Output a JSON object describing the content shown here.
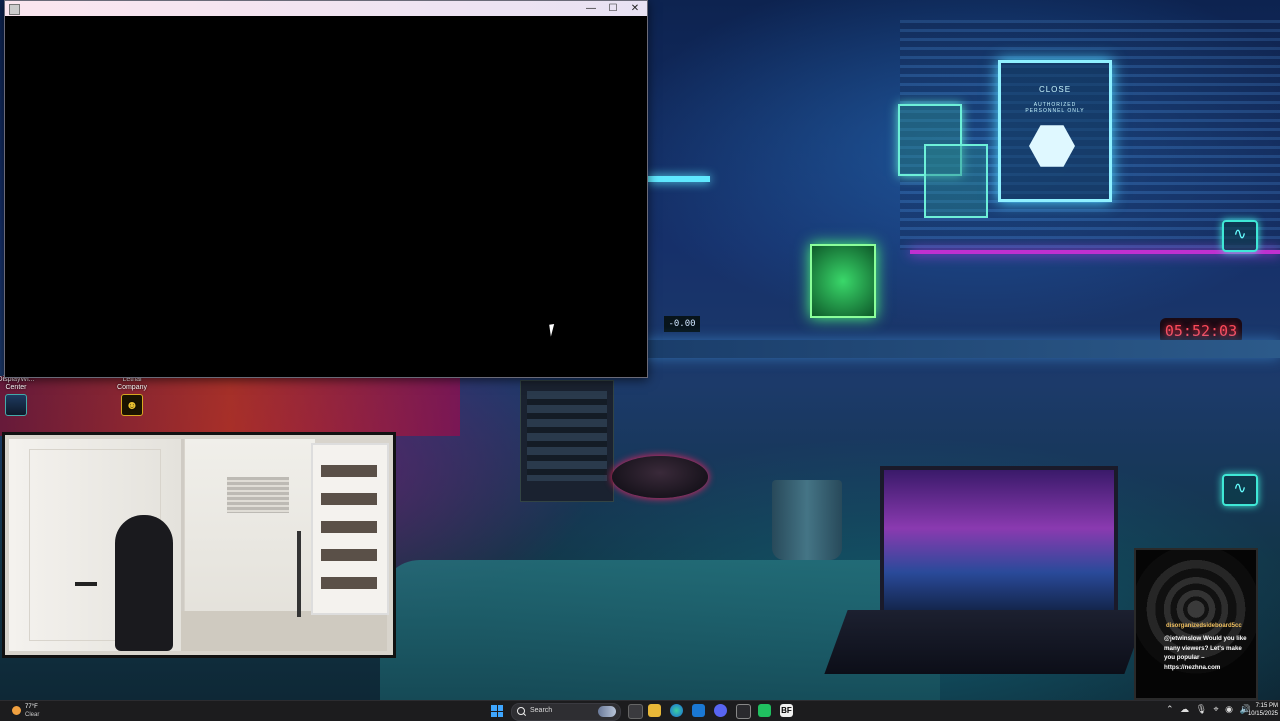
{
  "app_window": {
    "title": "",
    "controls": {
      "minimize": "—",
      "maximize": "☐",
      "close": "✕"
    }
  },
  "desktop_icons": [
    {
      "label": "DisplayWi... Center",
      "icon": "display-center-icon"
    },
    {
      "label": "Lethal Company",
      "icon": "lethal-company-icon"
    }
  ],
  "wallpaper": {
    "sign_text": "CLOSE",
    "sign_subtext": "AUTHORIZED PERSONNEL ONLY",
    "clock_readout": "05:52:03",
    "small_readout": "-0.00"
  },
  "chat_overlay": {
    "username": "disorganizedsideboard5cc",
    "message": "@jetwinslow Would you like many viewers? Let's make you popular – https://nezhna.com"
  },
  "taskbar": {
    "weather_temp": "77°F",
    "weather_condition": "Clear",
    "search_label": "Search",
    "time": "7:15 PM",
    "date": "10/15/2025",
    "apps": [
      "file-explorer-icon",
      "edge-icon",
      "outlook-icon",
      "discord-icon",
      "terminal-icon",
      "xbox-icon",
      "bf-icon"
    ]
  },
  "colors": {
    "taskbar_bg": "#1c1c1e",
    "titlebar_bg": "#fbe6ef",
    "clock_red": "#ff4a5a",
    "neon_cyan": "#5fe8ff",
    "start_blue": "#3ea6ff"
  }
}
